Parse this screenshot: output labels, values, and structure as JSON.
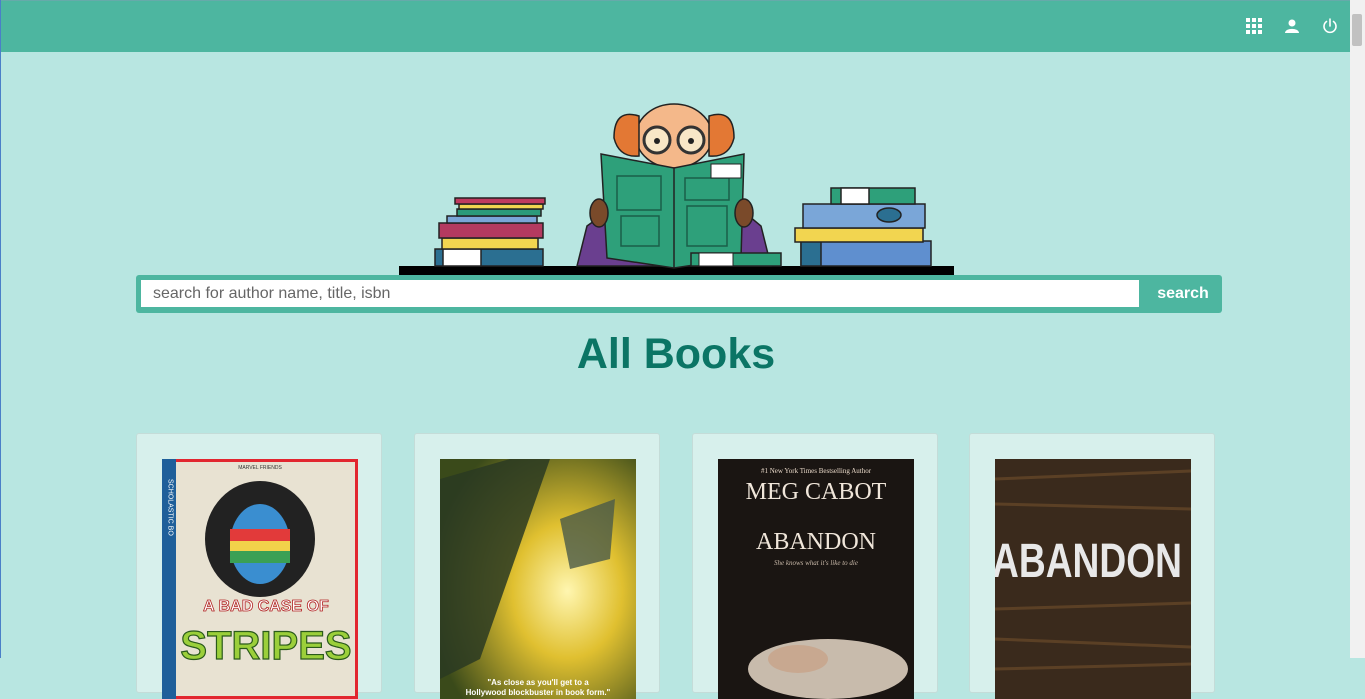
{
  "topbar": {
    "icons": [
      "apps-grid-icon",
      "user-icon",
      "power-icon"
    ],
    "color": "#4db6a0"
  },
  "search": {
    "placeholder": "search for author name, title, isbn",
    "button_label": "search"
  },
  "page": {
    "title": "All Books",
    "background": "#b8e6e1"
  },
  "books": [
    {
      "cover_series": "MARVEL FRIENDS",
      "cover_title_line1": "A BAD CASE OF",
      "cover_title_line2": "STRIPES",
      "cover_side": "SCHOLASTIC BO"
    },
    {
      "cover_quote_line1": "\"As close as you'll get to a",
      "cover_quote_line2": "Hollywood blockbuster in book form.\""
    },
    {
      "cover_tagline": "#1 New York Times Bestselling Author",
      "cover_author": "MEG CABOT",
      "cover_title": "ABANDON",
      "cover_subtitle": "She knows what it's like to die"
    },
    {
      "cover_title": "ABANDON"
    }
  ]
}
